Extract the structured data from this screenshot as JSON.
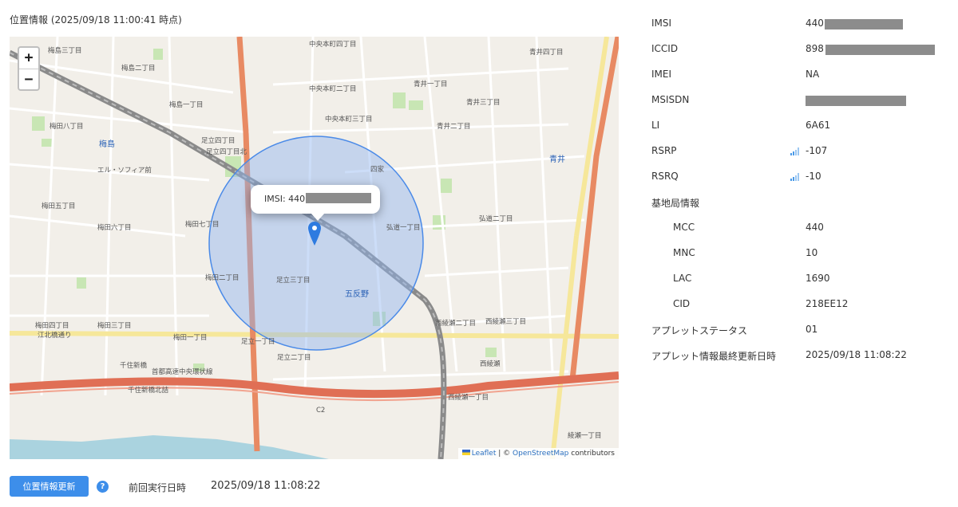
{
  "map_title": "位置情報 (2025/09/18 11:00:41 時点)",
  "map": {
    "zoom_in": "+",
    "zoom_out": "−",
    "popup_prefix": "IMSI: 440",
    "attribution": {
      "leaflet": "Leaflet",
      "separator": " | © ",
      "osm": "OpenStreetMap",
      "contributors": " contributors"
    },
    "labels": [
      "梅島三丁目",
      "梅島二丁目",
      "梅島一丁目",
      "梅田八丁目",
      "梅田七丁目",
      "梅田六丁目",
      "梅田五丁目",
      "梅田四丁目",
      "梅田三丁目",
      "梅田二丁目",
      "梅田一丁目",
      "梅島",
      "エル・ソフィア前",
      "中央本町四丁目",
      "中央本町三丁目",
      "中央本町二丁目",
      "足立四丁目",
      "足立四丁目北",
      "足立三丁目",
      "足立二丁目",
      "足立一丁目",
      "青井一丁目",
      "青井二丁目",
      "青井三丁目",
      "青井四丁目",
      "青井",
      "弘道一丁目",
      "弘道二丁目",
      "西綾瀬二丁目",
      "西綾瀬一丁目",
      "西綾瀬三丁目",
      "西綾瀬",
      "綾瀬一丁目",
      "五反野",
      "江北橋通り",
      "千住新橋",
      "千住新橋北詰",
      "首都高速中央環状線",
      "C2",
      "四家"
    ]
  },
  "info": {
    "imsi": {
      "label": "IMSI",
      "value": "440"
    },
    "iccid": {
      "label": "ICCID",
      "value": "898"
    },
    "imei": {
      "label": "IMEI",
      "value": "NA"
    },
    "msisdn": {
      "label": "MSISDN",
      "value": ""
    },
    "li": {
      "label": "LI",
      "value": "6A61"
    },
    "rsrp": {
      "label": "RSRP",
      "value": "-107"
    },
    "rsrq": {
      "label": "RSRQ",
      "value": "-10"
    },
    "base_station": {
      "label": "基地局情報"
    },
    "mcc": {
      "label": "MCC",
      "value": "440"
    },
    "mnc": {
      "label": "MNC",
      "value": "10"
    },
    "lac": {
      "label": "LAC",
      "value": "1690"
    },
    "cid": {
      "label": "CID",
      "value": "218EE12"
    },
    "applet_status": {
      "label": "アプレットステータス",
      "value": "01"
    },
    "applet_updated": {
      "label": "アプレット情報最終更新日時",
      "value": "2025/09/18 11:08:22"
    }
  },
  "footer": {
    "refresh_button": "位置情報更新",
    "help_icon": "?",
    "last_run_label": "前回実行日時",
    "last_run_value": "2025/09/18 11:08:22"
  },
  "colors": {
    "accent": "#3d8eea",
    "circle_fill": "#8fb4ef",
    "circle_stroke": "#4a8ae8",
    "mask": "#8c8c8c"
  },
  "icons": [
    "zoom-in-icon",
    "zoom-out-icon",
    "map-marker-icon",
    "signal-icon",
    "help-icon",
    "ukraine-flag-icon"
  ]
}
